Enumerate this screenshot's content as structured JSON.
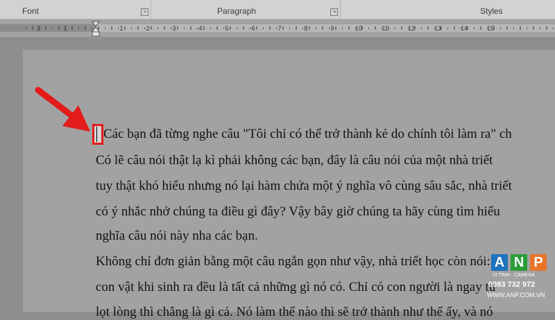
{
  "ribbon": {
    "groups": [
      {
        "label": "Font"
      },
      {
        "label": "Paragraph"
      },
      {
        "label": "Styles"
      }
    ]
  },
  "ruler": {
    "numbers": [
      "2",
      "1",
      "1",
      "2",
      "3",
      "4",
      "5",
      "6",
      "7",
      "8",
      "9",
      "10",
      "11",
      "12",
      "13",
      "14",
      "15"
    ]
  },
  "document": {
    "lines": [
      "Các bạn đã từng nghe câu \"Tôi chỉ có thể trở thành kẻ do chính tôi làm ra\" ch",
      "Có lẽ câu nói thật lạ kì phải không các bạn, đây là câu nói của một nhà triết",
      "tuy thật khó hiểu nhưng nó lại hàm chứa một ý nghĩa vô cùng sâu sắc, nhà triết",
      "có ý nhắc nhở chúng ta điều gì đây? Vậy bây giờ chúng ta hãy cùng tìm hiểu",
      "nghĩa câu nói này nha các bạn.",
      "Không chỉ đơn giản bằng một câu ngắn gọn như vậy, nhà triết học còn nói:\"",
      "con vật khi sinh ra đều là tất cả những gì nó có. Chỉ có con người là ngay từ",
      "lọt lòng thì chẳng là gì cả. Nó làm thế nào thì sẽ trở thành như thế ấy, và nó"
    ]
  },
  "watermark": {
    "letters": [
      "A",
      "N",
      "P"
    ],
    "tagline": "VI TÍNH · CAMERA",
    "phone": "0983 732 972",
    "website": "WWW.ANP.COM.VN"
  },
  "colors": {
    "highlight": "#e31b1b",
    "logo_a": "#1e73be",
    "logo_n": "#2a9d3a",
    "logo_p": "#e8742a"
  }
}
